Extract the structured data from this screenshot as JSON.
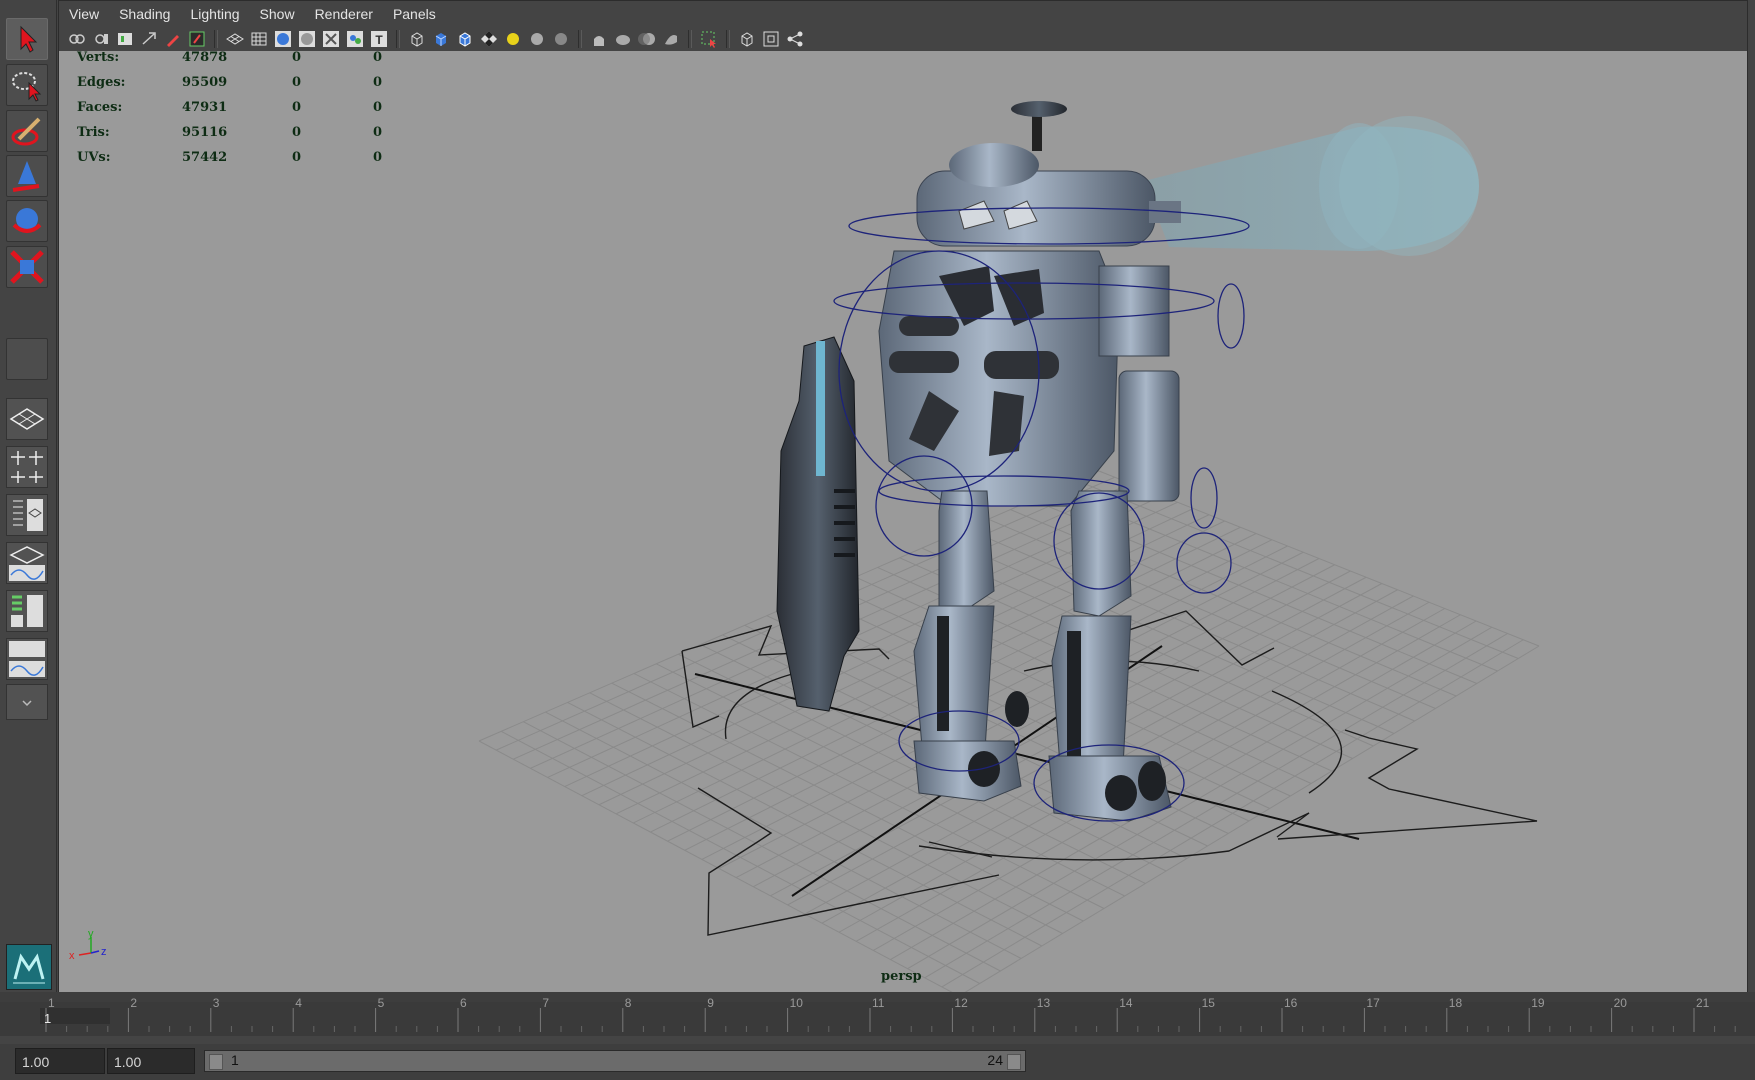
{
  "menubar": {
    "items": [
      "View",
      "Shading",
      "Lighting",
      "Show",
      "Renderer",
      "Panels"
    ]
  },
  "toolbox": {
    "tools": [
      "select-tool-icon",
      "lasso-tool-icon",
      "paint-select-tool-icon",
      "move-tool-icon",
      "rotate-tool-icon",
      "scale-tool-icon"
    ],
    "logo": "maya-logo-icon"
  },
  "hud": {
    "rows": [
      {
        "label": "Verts:",
        "v1": "47878",
        "v2": "0",
        "v3": "0"
      },
      {
        "label": "Edges:",
        "v1": "95509",
        "v2": "0",
        "v3": "0"
      },
      {
        "label": "Faces:",
        "v1": "47931",
        "v2": "0",
        "v3": "0"
      },
      {
        "label": "Tris:",
        "v1": "95116",
        "v2": "0",
        "v3": "0"
      },
      {
        "label": "UVs:",
        "v1": "57442",
        "v2": "0",
        "v3": "0"
      }
    ]
  },
  "viewport": {
    "camera": "persp",
    "background": "#9a9a9a",
    "axis_labels": {
      "x": "x",
      "y": "y",
      "z": "z"
    }
  },
  "timeline": {
    "current_frame": "1",
    "ticks": [
      "1",
      "2",
      "3",
      "4",
      "5",
      "6",
      "7",
      "8",
      "9",
      "10",
      "11",
      "12",
      "13",
      "14",
      "15",
      "16",
      "17",
      "18",
      "19",
      "20",
      "21"
    ]
  },
  "range": {
    "start_field": "1.00",
    "anim_start_field": "1.00",
    "range_start": "1",
    "range_end": "24"
  }
}
